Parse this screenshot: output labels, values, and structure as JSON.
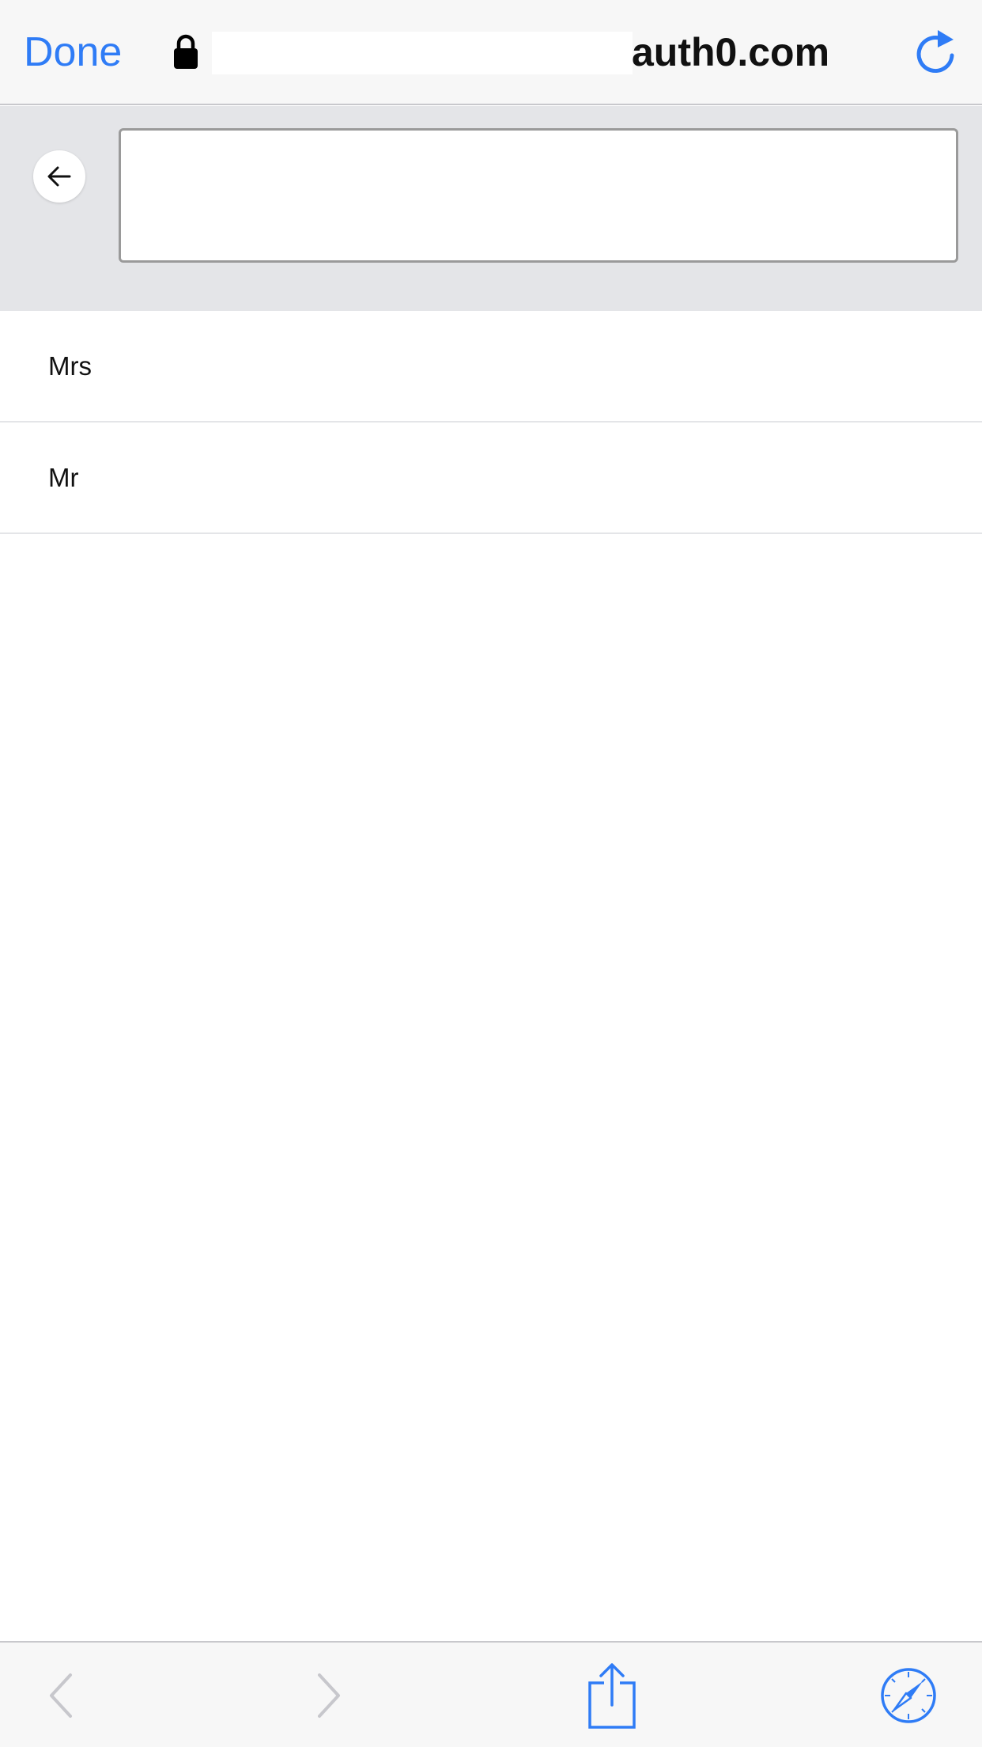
{
  "browser": {
    "done_label": "Done",
    "url_domain": "auth0.com",
    "accent_color": "#2f7cf6"
  },
  "icons": {
    "lock": "lock-icon",
    "reload": "reload-icon",
    "back_arrow": "arrow-left-icon",
    "nav_back": "chevron-left-icon",
    "nav_forward": "chevron-right-icon",
    "share": "share-icon",
    "compass": "compass-icon"
  },
  "search": {
    "value": "",
    "placeholder": ""
  },
  "options": [
    {
      "label": "Mrs"
    },
    {
      "label": "Mr"
    }
  ]
}
